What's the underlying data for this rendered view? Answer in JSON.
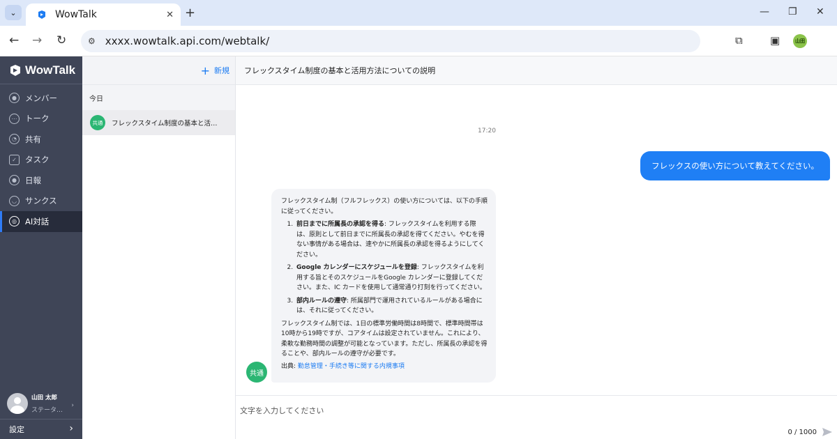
{
  "browser": {
    "tab_title": "WowTalk",
    "url": "xxxx.wowtalk.api.com/webtalk/",
    "profile_label": "山田"
  },
  "sidebar": {
    "brand": "WowTalk",
    "items": [
      {
        "label": "メンバー",
        "icon": "member-icon"
      },
      {
        "label": "トーク",
        "icon": "talk-icon"
      },
      {
        "label": "共有",
        "icon": "share-icon"
      },
      {
        "label": "タスク",
        "icon": "task-icon"
      },
      {
        "label": "日報",
        "icon": "daily-report-icon"
      },
      {
        "label": "サンクス",
        "icon": "thanks-icon"
      },
      {
        "label": "AI対話",
        "icon": "ai-chat-icon",
        "active": true
      }
    ],
    "user": {
      "name": "山田 太郎",
      "status": "ステータ…"
    },
    "settings_label": "設定"
  },
  "conversations": {
    "new_label": "新規",
    "section_label": "今日",
    "items": [
      {
        "badge": "共通",
        "title": "フレックスタイム制度の基本と活用…"
      }
    ]
  },
  "chat": {
    "title": "フレックスタイム制度の基本と活用方法についての説明",
    "timestamp": "17:20",
    "user_message": "フレックスの使い方について教えてください。",
    "bot_badge": "共通",
    "bot": {
      "intro": "フレックスタイム制（フルフレックス）の使い方については、以下の手順に従ってください。",
      "steps": [
        {
          "title": "前日までに所属長の承認を得る",
          "text": ": フレックスタイムを利用する際は、原則として前日までに所属長の承認を得てください。やむを得ない事情がある場合は、速やかに所属長の承認を得るようにしてください。"
        },
        {
          "title": "Google カレンダーにスケジュールを登録",
          "text": ": フレックスタイムを利用する旨とそのスケジュールをGoogle カレンダーに登録してください。また、IC カードを使用して通常通り打刻を行ってください。"
        },
        {
          "title": "部内ルールの遵守",
          "text": ": 所属部門で運用されているルールがある場合には、それに従ってください。"
        }
      ],
      "outro": "フレックスタイム制では、1日の標準労働時間は8時間で、標準時間帯は10時から19時ですが、コアタイムは設定されていません。これにより、柔軟な勤務時間の調整が可能となっています。ただし、所属長の承認を得ることや、部内ルールの遵守が必要です。",
      "source_label": "出典:",
      "source_link": "勤怠管理・手続き等に関する内規事項"
    },
    "composer": {
      "placeholder": "文字を入力してください",
      "count": "0 / 1000"
    }
  },
  "colors": {
    "accent": "#1f7ff5",
    "sidebar_bg": "#3f4557",
    "badge_green": "#2bb673"
  }
}
